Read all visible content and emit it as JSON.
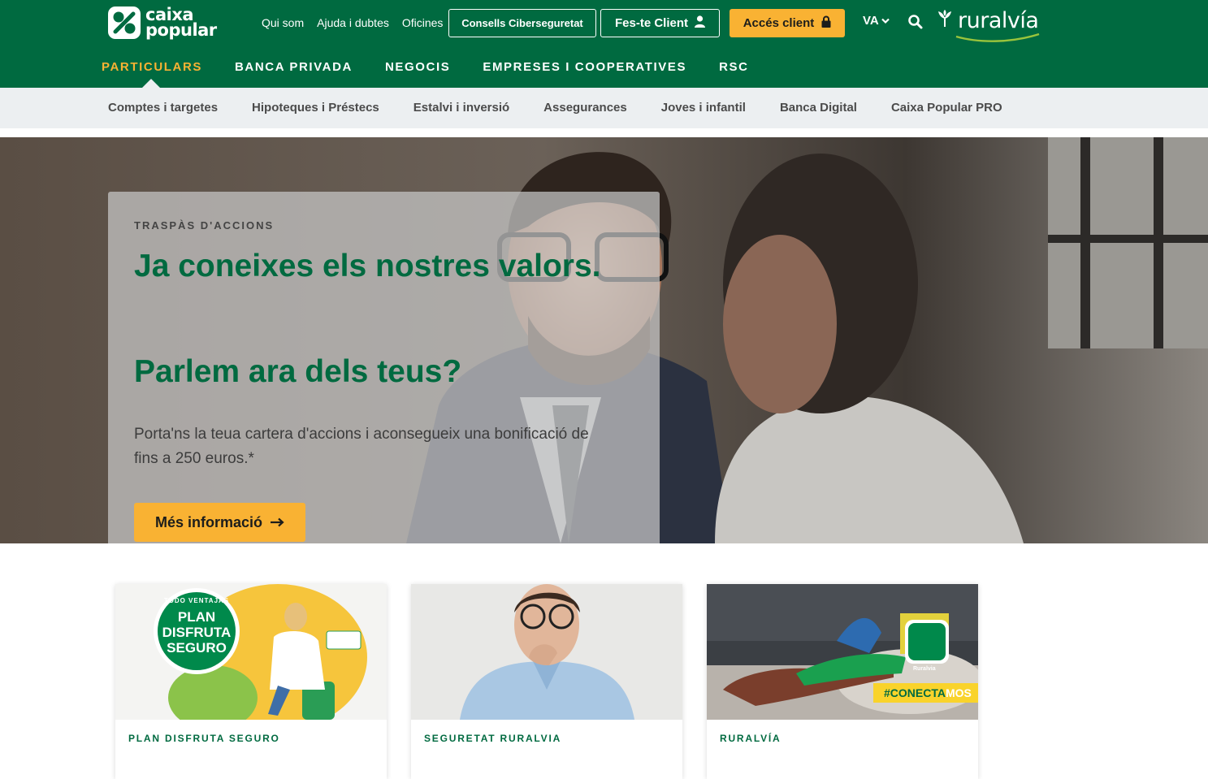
{
  "brand": {
    "logo_line1": "caixa",
    "logo_line2": "popular",
    "ruralvia": "ruralvía"
  },
  "header": {
    "links": [
      "Qui som",
      "Ajuda i dubtes",
      "Oficines"
    ],
    "cyber_button": "Consells Ciberseguretat",
    "join_button": "Fes-te Client",
    "login_button": "Accés client",
    "language": "VA"
  },
  "main_nav": {
    "items": [
      "PARTICULARS",
      "BANCA PRIVADA",
      "NEGOCIS",
      "EMPRESES I COOPERATIVES",
      "RSC"
    ],
    "active": "PARTICULARS"
  },
  "sub_nav": {
    "items": [
      "Comptes i targetes",
      "Hipoteques i Préstecs",
      "Estalvi i inversió",
      "Assegurances",
      "Joves i infantil",
      "Banca Digital",
      "Caixa Popular PRO"
    ]
  },
  "hero": {
    "eyebrow": "TRASPÀS D'ACCIONS",
    "title": "Ja coneixes els nostres valors.",
    "title2": "Parlem ara dels teus?",
    "body": "Porta'ns la teua cartera d'accions i aconsegueix una bonificació de fins a 250 euros.*",
    "button": "Més informació"
  },
  "cards": [
    {
      "label": "PLAN DISFRUTA SEGURO",
      "badge_small": "TODO VENTAJAS",
      "badge_lines": [
        "PLAN",
        "DISFRUTA",
        "SEGURO"
      ]
    },
    {
      "label": "SEGURETAT RURALVIA"
    },
    {
      "label": "RURALVÍA",
      "tag_a": "#CONECTA",
      "tag_b": "MOS",
      "app_label": "Ruralvia"
    }
  ],
  "colors": {
    "brand_green": "#006a40",
    "accent_yellow": "#f9b233",
    "subnav_bg": "#eceff1"
  }
}
